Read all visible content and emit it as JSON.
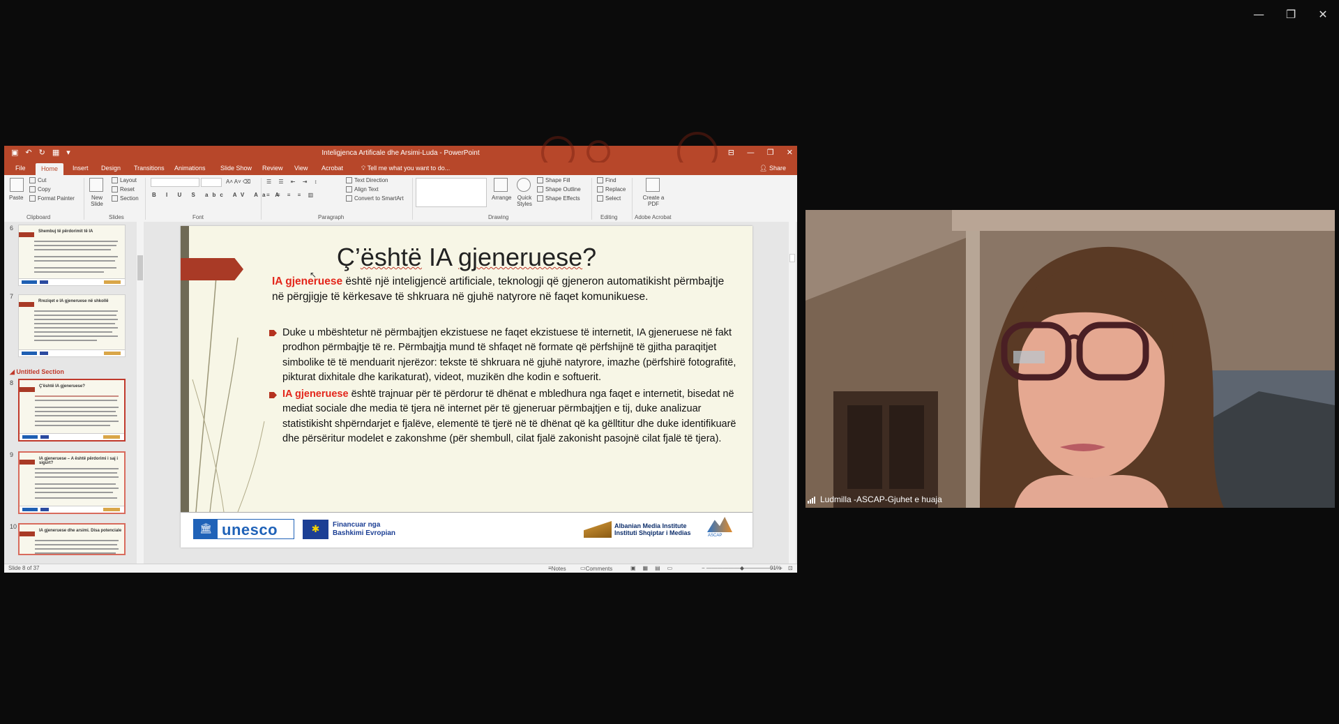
{
  "meeting": {
    "controls": {
      "minimize": "—",
      "restore": "❐",
      "close": "✕"
    },
    "participant": {
      "name": "Ludmilla -ASCAP-Gjuhet e huaja"
    }
  },
  "ppt": {
    "window_title": "Inteligjenca Artificale dhe Arsimi-Luda - PowerPoint",
    "tabs": [
      "File",
      "Home",
      "Insert",
      "Design",
      "Transitions",
      "Animations",
      "Slide Show",
      "Review",
      "View",
      "Acrobat"
    ],
    "active_tab": "Home",
    "tell_me": "Tell me what you want to do...",
    "share": "Share",
    "ribbon": {
      "clipboard": {
        "paste": "Paste",
        "cut": "Cut",
        "copy": "Copy",
        "format_painter": "Format Painter",
        "label": "Clipboard"
      },
      "slides": {
        "new_slide": "New Slide",
        "layout": "Layout",
        "reset": "Reset",
        "section": "Section",
        "label": "Slides"
      },
      "font": {
        "label": "Font"
      },
      "paragraph": {
        "text_direction": "Text Direction",
        "align_text": "Align Text",
        "convert_smartart": "Convert to SmartArt",
        "label": "Paragraph"
      },
      "drawing": {
        "arrange": "Arrange",
        "quick_styles": "Quick Styles",
        "shape_fill": "Shape Fill",
        "shape_outline": "Shape Outline",
        "shape_effects": "Shape Effects",
        "label": "Drawing"
      },
      "editing": {
        "find": "Find",
        "replace": "Replace",
        "select": "Select",
        "label": "Editing"
      },
      "acrobat": {
        "create_pdf": "Create a PDF",
        "label": "Adobe Acrobat"
      }
    },
    "thumbnails": {
      "slides": [
        {
          "number": "6",
          "title": "Shembuj të përdorimit të IA"
        },
        {
          "number": "7",
          "title": "Rreziqet e IA gjeneruese në shkollë"
        },
        {
          "number": "8",
          "title": "Ç'është IA gjeneruese?"
        },
        {
          "number": "9",
          "title": "IA gjeneruese – A është përdorimi i saj i sigurt?"
        },
        {
          "number": "10",
          "title": "IA gjeneruese dhe arsimi. Disa potenciale"
        }
      ],
      "section_name": "Untitled Section"
    },
    "slide": {
      "title_prefix": "Ç’",
      "title_word1": "është",
      "title_mid": " IA ",
      "title_word2": "gjeneruese",
      "title_suffix": "?",
      "intro_highlight": "IA gjeneruese",
      "intro_text": " është një inteligjencë artificiale, teknologji që gjeneron automatikisht përmbajtje në përgjigje të kërkesave të shkruara në gjuhë natyrore në faqet komunikuese.",
      "bullet1": "Duke u mbështetur në përmbajtjen ekzistuese ne faqet ekzistuese të internetit, IA gjeneruese në fakt prodhon përmbajtje të re. Përmbajtja mund të shfaqet në formate që përfshijnë të gjitha paraqitjet simbolike të të menduarit njerëzor: tekste të shkruara në gjuhë natyrore, imazhe (përfshirë fotografitë, pikturat dixhitale dhe karikaturat), videot, muzikën dhe kodin e softuerit.",
      "bullet2_highlight": "IA gjeneruese",
      "bullet2_text": " është trajnuar për të përdorur të dhënat e mbledhura nga faqet e internetit, bisedat në mediat sociale dhe media të tjera në internet për të gjeneruar përmbajtjen e tij, duke analizuar statistikisht shpërndarjet e fjalëve,  elementë të tjerë në të dhënat që ka gëlltitur dhe duke identifikuarë dhe përsëritur  modelet e zakonshme (për shembull, cilat fjalë zakonisht pasojnë cilat fjalë të tjera).",
      "footer": {
        "unesco": "unesco",
        "eu_line1": "Financuar nga",
        "eu_line2": "Bashkimi Evropian",
        "ami_line1": "Albanian Media Institute",
        "ami_line2": "Instituti Shqiptar i Medias",
        "ascap": "ASCAP"
      }
    },
    "status": {
      "slide_counter": "Slide 8 of 37",
      "notes": "Notes",
      "comments": "Comments",
      "zoom": "91%"
    }
  },
  "colors": {
    "ppt_accent": "#b7472a",
    "highlight_red": "#e3261b",
    "unesco_blue": "#1f62b8"
  }
}
